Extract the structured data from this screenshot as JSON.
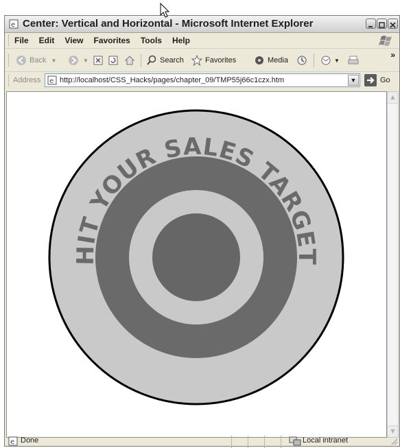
{
  "window": {
    "title": "Center: Vertical and Horizontal - Microsoft Internet Explorer"
  },
  "menu": {
    "items": [
      "File",
      "Edit",
      "View",
      "Favorites",
      "Tools",
      "Help"
    ]
  },
  "toolbar": {
    "back_label": "Back",
    "search_label": "Search",
    "favorites_label": "Favorites",
    "media_label": "Media"
  },
  "address": {
    "label": "Address",
    "url": "http://localhost/CSS_Hacks/pages/chapter_09/TMP55j66c1czx.htm",
    "go_label": "Go"
  },
  "content": {
    "target_text": "HIT YOUR SALES TARGET",
    "colors": {
      "outer_ring": "#c9c9c9",
      "middle_ring": "#6a6a6a",
      "bullseye": "#666666",
      "text": "#6a6a6a"
    }
  },
  "status": {
    "text": "Done",
    "zone": "Local intranet"
  }
}
